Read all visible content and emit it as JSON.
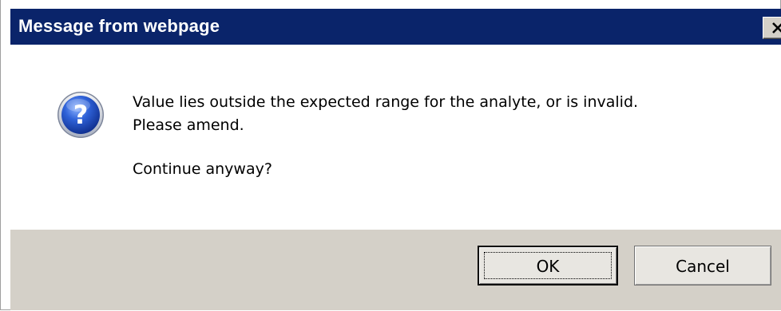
{
  "dialog": {
    "title": "Message from webpage",
    "close_icon": "close-icon",
    "icon": "question-icon",
    "message_line1": "Value lies outside the expected range for the analyte, or is invalid.",
    "message_line2": "Please amend.",
    "message_line3": "Continue anyway?",
    "buttons": {
      "ok_label": "OK",
      "cancel_label": "Cancel"
    }
  },
  "colors": {
    "titlebar": "#0a246a",
    "footer": "#d4d0c8"
  }
}
